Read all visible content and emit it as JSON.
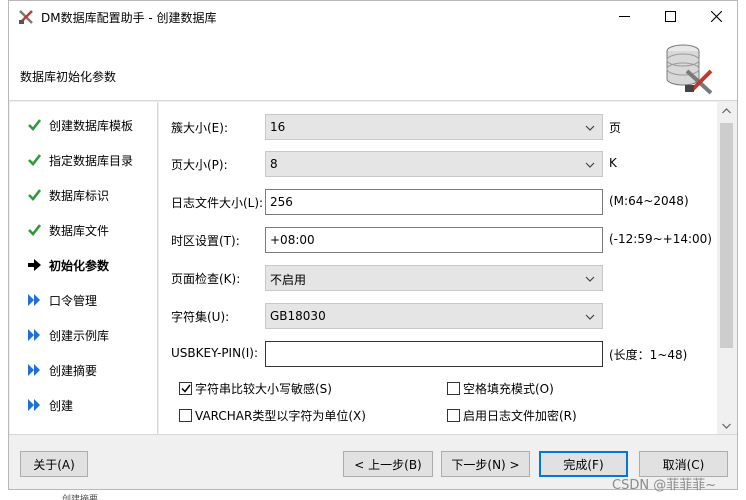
{
  "window": {
    "title": "DM数据库配置助手 - 创建数据库",
    "header_title": "数据库初始化参数"
  },
  "steps": [
    {
      "label": "创建数据库模板",
      "state": "done"
    },
    {
      "label": "指定数据库目录",
      "state": "done"
    },
    {
      "label": "数据库标识",
      "state": "done"
    },
    {
      "label": "数据库文件",
      "state": "done"
    },
    {
      "label": "初始化参数",
      "state": "current"
    },
    {
      "label": "口令管理",
      "state": "pending"
    },
    {
      "label": "创建示例库",
      "state": "pending"
    },
    {
      "label": "创建摘要",
      "state": "pending"
    },
    {
      "label": "创建",
      "state": "pending"
    }
  ],
  "form": {
    "extent_size": {
      "label": "簇大小(E):",
      "value": "16",
      "suffix": "页"
    },
    "page_size": {
      "label": "页大小(P):",
      "value": "8",
      "suffix": "K"
    },
    "log_size": {
      "label": "日志文件大小(L):",
      "value": "256",
      "suffix": "(M:64~2048)"
    },
    "timezone": {
      "label": "时区设置(T):",
      "value": "+08:00",
      "suffix": "(-12:59~+14:00)"
    },
    "page_check": {
      "label": "页面检查(K):",
      "value": "不启用"
    },
    "charset": {
      "label": "字符集(U):",
      "value": "GB18030"
    },
    "usbkey_pin": {
      "label": "USBKEY-PIN(I):",
      "value": "",
      "suffix": "(长度：1~48)"
    }
  },
  "checkboxes": {
    "case_sensitive": {
      "label": "字符串比较大小写敏感(S)",
      "checked": true
    },
    "blank_pad": {
      "label": "空格填充模式(O)",
      "checked": false
    },
    "varchar_char": {
      "label": "VARCHAR类型以字符为单位(X)",
      "checked": false
    },
    "log_encrypt": {
      "label": "启用日志文件加密(R)",
      "checked": false
    }
  },
  "buttons": {
    "about": "关于(A)",
    "back": "< 上一步(B)",
    "next": "下一步(N) >",
    "finish": "完成(F)",
    "cancel": "取消(C)"
  },
  "background_fragment": "创建摘要",
  "watermark": "CSDN @菲菲菲~",
  "colors": {
    "check_green": "#2e9b3a",
    "pending_blue": "#1e6fd9",
    "accent": "#0078d7"
  }
}
